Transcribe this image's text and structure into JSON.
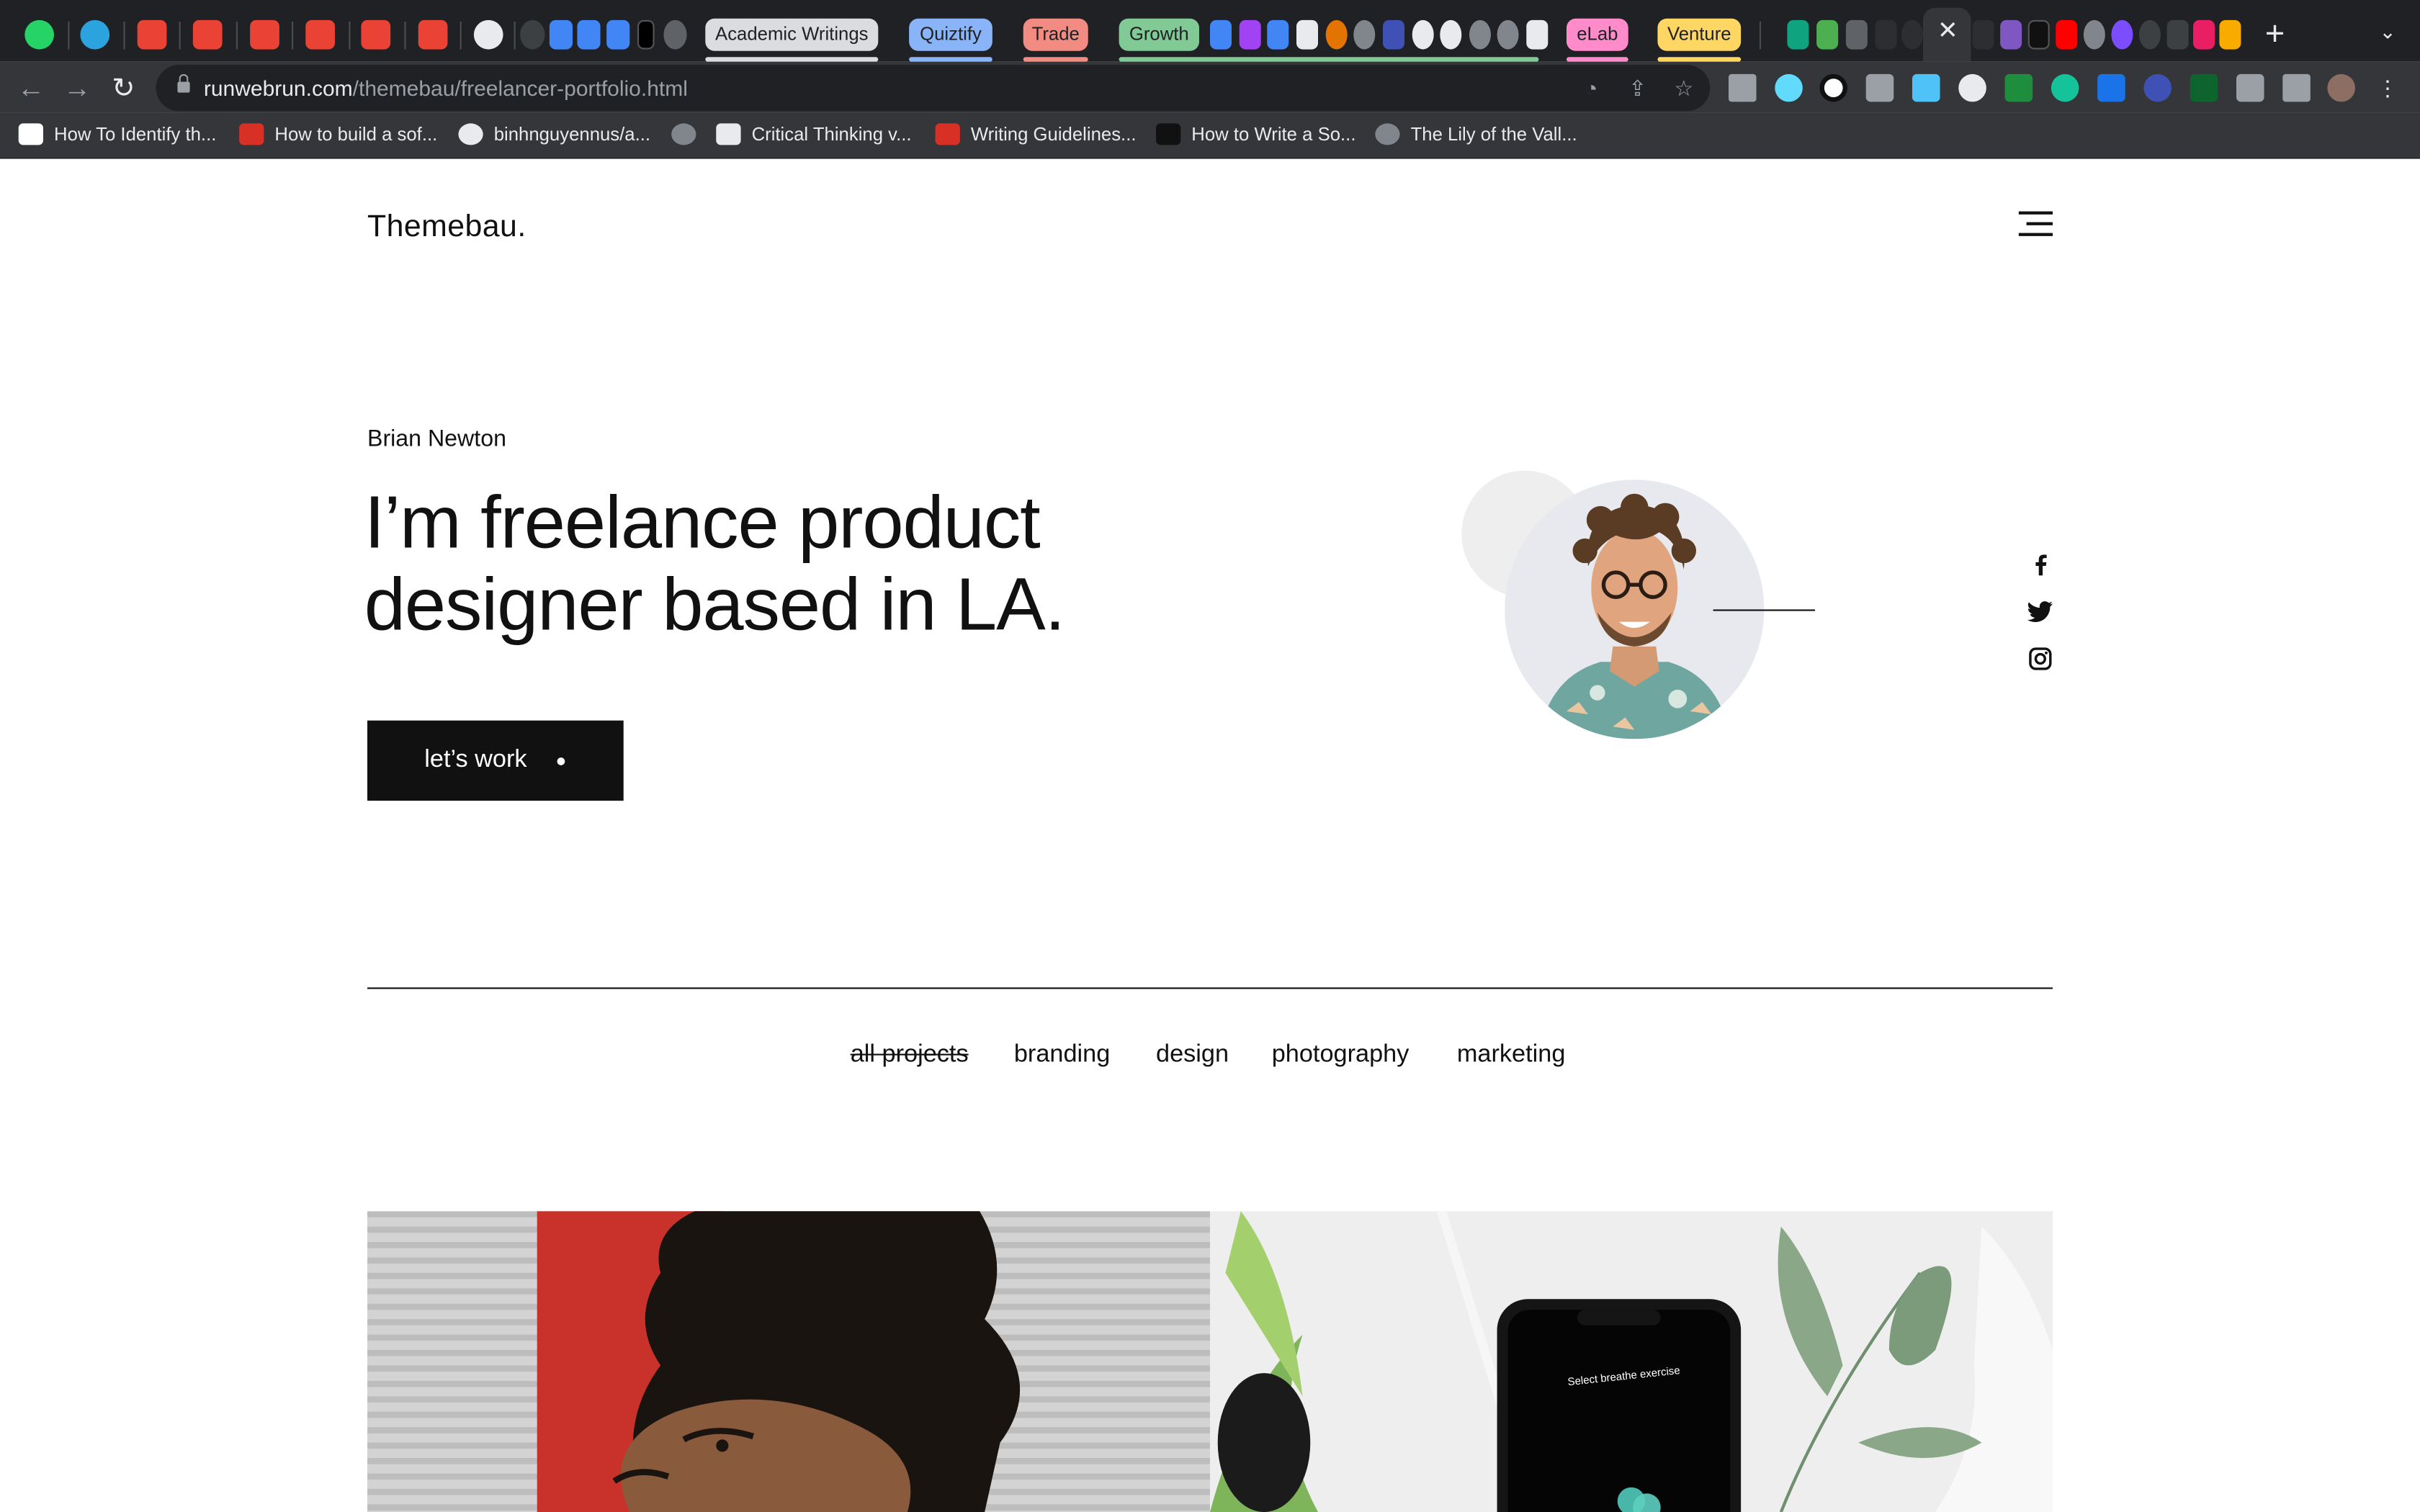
{
  "browser": {
    "tab_groups": [
      {
        "label": "Academic Writings",
        "color": "#dadce0"
      },
      {
        "label": "Quiztify",
        "color": "#8ab4f8"
      },
      {
        "label": "Trade",
        "color": "#f28b82"
      },
      {
        "label": "Growth",
        "color": "#81c995"
      },
      {
        "label": "eLab",
        "color": "#ff8bcb"
      },
      {
        "label": "Venture",
        "color": "#fdd663"
      }
    ],
    "url": {
      "host": "runwebrun.com",
      "path": "/themebau/freelancer-portfolio.html"
    },
    "bookmarks": [
      {
        "label": "How To Identify th...",
        "icon": "medium-icon"
      },
      {
        "label": "How to build a sof...",
        "icon": "n-icon"
      },
      {
        "label": "binhnguyennus/a...",
        "icon": "github-icon"
      },
      {
        "label": "",
        "icon": "globe-icon"
      },
      {
        "label": "Critical Thinking v...",
        "icon": "document-icon"
      },
      {
        "label": "Writing Guidelines...",
        "icon": "m-icon"
      },
      {
        "label": "How to Write a So...",
        "icon": "r-icon"
      },
      {
        "label": "The Lily of the Vall...",
        "icon": "globe-icon"
      }
    ]
  },
  "site": {
    "logo": "Themebau.",
    "author": "Brian Newton",
    "headline_line1": "I’m freelance product",
    "headline_line2": "designer based in LA.",
    "cta_label": "let’s work",
    "social": [
      "facebook-icon",
      "twitter-icon",
      "instagram-icon"
    ],
    "filters": [
      "all projects",
      "branding",
      "design",
      "photography",
      "marketing"
    ],
    "active_filter": "all projects",
    "phone_screen_text": "Select breathe exercise"
  }
}
